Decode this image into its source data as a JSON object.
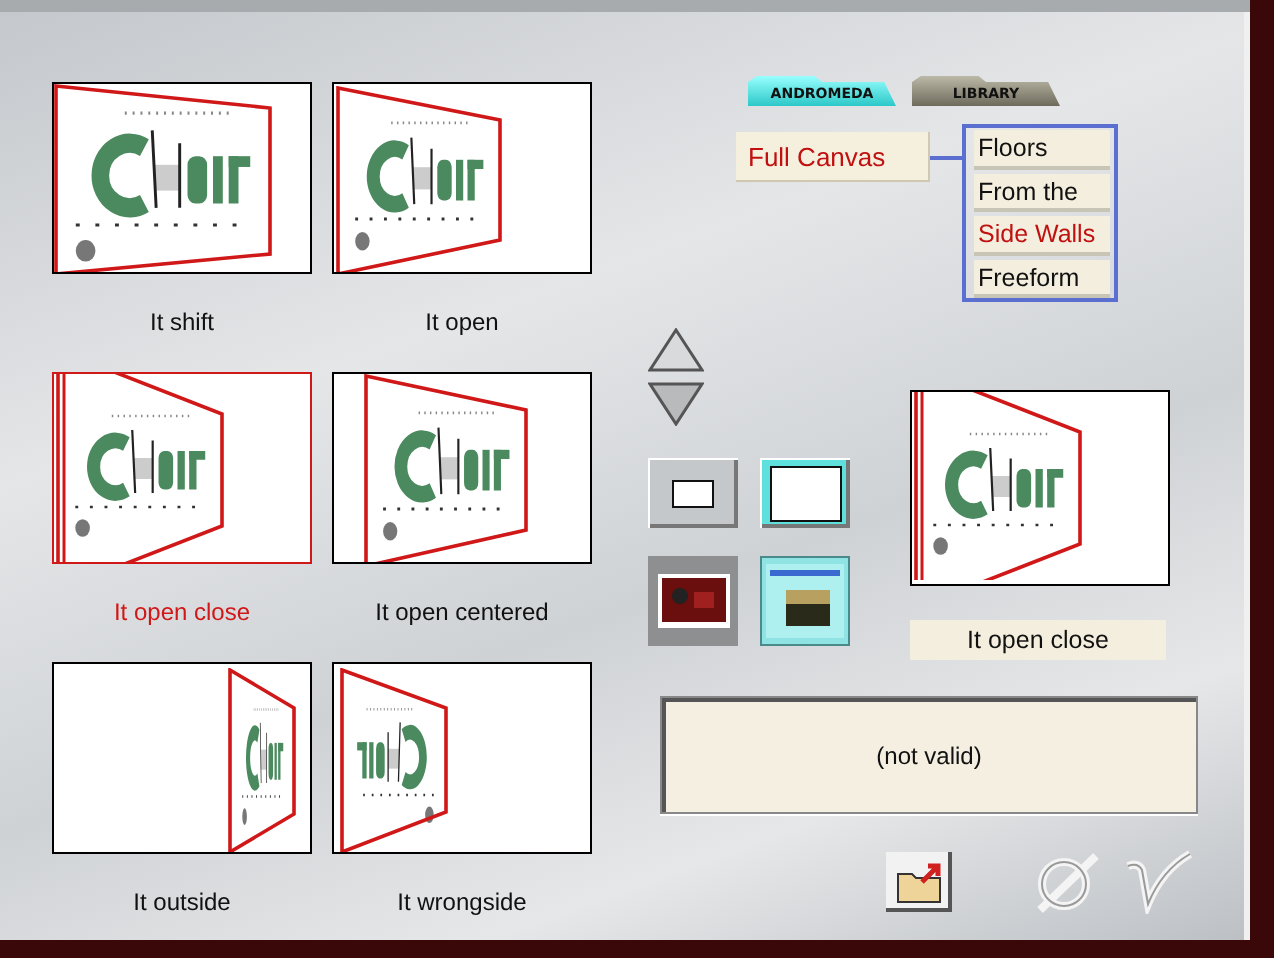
{
  "thumbnails": [
    {
      "label": "It shift",
      "kind": "shift",
      "selected": false
    },
    {
      "label": "It open",
      "kind": "open",
      "selected": false
    },
    {
      "label": "It open close",
      "kind": "open-close",
      "selected": true
    },
    {
      "label": "It open centered",
      "kind": "centered",
      "selected": false
    },
    {
      "label": "It outside",
      "kind": "outside",
      "selected": false
    },
    {
      "label": "It wrongside",
      "kind": "wrongside",
      "selected": false
    }
  ],
  "tabs": [
    {
      "label": "ANDROMEDA",
      "selected": true
    },
    {
      "label": "LIBRARY",
      "selected": false
    }
  ],
  "mode_field": {
    "value": "Full Canvas"
  },
  "mode_options": [
    {
      "label": "Floors",
      "selected": false
    },
    {
      "label": "From the",
      "selected": false
    },
    {
      "label": "Side Walls",
      "selected": true
    },
    {
      "label": "Freeform",
      "selected": false
    }
  ],
  "frame_buttons": [
    {
      "kind": "small-frame",
      "selected": false
    },
    {
      "kind": "full-frame",
      "selected": true
    }
  ],
  "background_buttons": [
    {
      "kind": "photo",
      "selected": false
    },
    {
      "kind": "perspective",
      "selected": true
    }
  ],
  "preview": {
    "kind": "open-close",
    "caption": "It open close"
  },
  "status": "(not valid)"
}
